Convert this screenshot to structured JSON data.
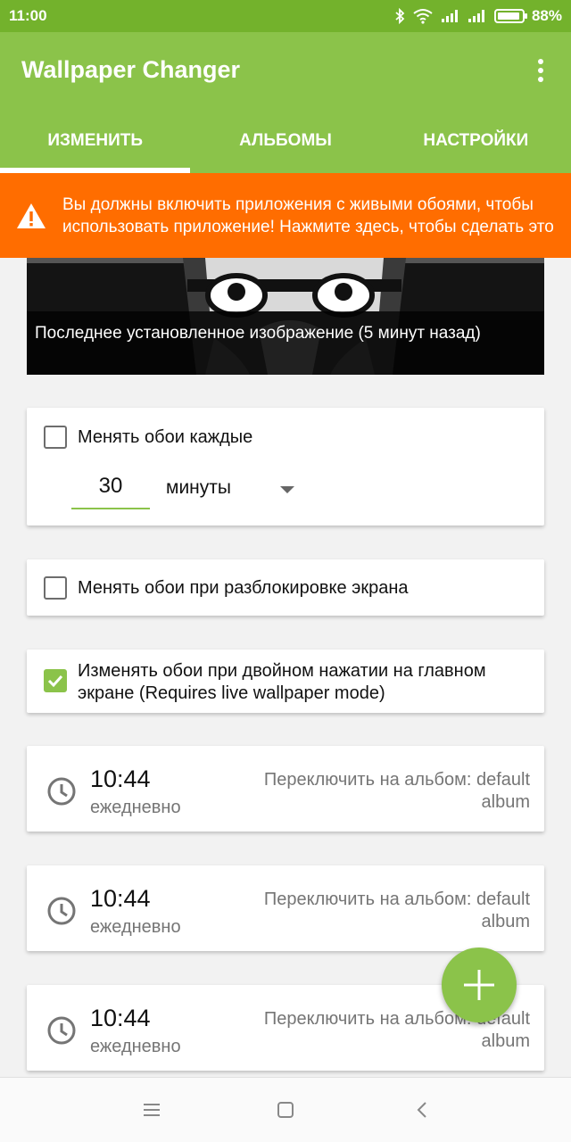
{
  "status": {
    "time": "11:00",
    "battery": "88%"
  },
  "app": {
    "title": "Wallpaper Changer"
  },
  "tabs": [
    {
      "label": "ИЗМЕНИТЬ",
      "active": true
    },
    {
      "label": "АЛЬБОМЫ",
      "active": false
    },
    {
      "label": "НАСТРОЙКИ",
      "active": false
    }
  ],
  "warning": {
    "text": "Вы должны включить приложения с живыми обоями, чтобы использовать приложение! Нажмите здесь, чтобы сделать это"
  },
  "preview": {
    "caption": "Последнее установленное изображение (5 минут назад)"
  },
  "interval": {
    "label": "Менять обои каждые",
    "checked": false,
    "value": "30",
    "unit": "минуты"
  },
  "unlock": {
    "label": "Менять обои при разблокировке экрана",
    "checked": false
  },
  "doubletap": {
    "label": "Изменять обои при двойном нажатии на главном экране (Requires live wallpaper mode)",
    "checked": true
  },
  "schedules": [
    {
      "time": "10:44",
      "frequency": "ежедневно",
      "action": "Переключить на альбом: default album"
    },
    {
      "time": "10:44",
      "frequency": "ежедневно",
      "action": "Переключить на альбом: default album"
    },
    {
      "time": "10:44",
      "frequency": "ежедневно",
      "action": "Переключить на альбом: default album"
    }
  ],
  "icons": {
    "bluetooth": "bluetooth-icon",
    "wifi": "wifi-icon",
    "signal": "signal-icon",
    "battery": "battery-icon",
    "overflow": "more-vert-icon",
    "warning": "warning-icon",
    "clock": "clock-icon",
    "add": "add-icon",
    "nav_menu": "menu-icon",
    "nav_home": "home-icon",
    "nav_back": "back-icon"
  },
  "colors": {
    "primary": "#8bc34a",
    "status_bar": "#73b22c",
    "warning": "#ff6d00"
  }
}
